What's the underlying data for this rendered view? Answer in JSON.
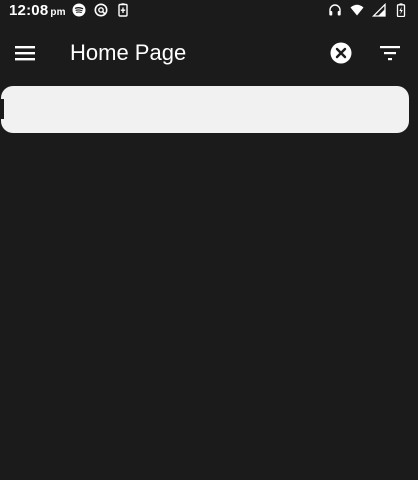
{
  "status_bar": {
    "time": "12:08",
    "ampm": "pm",
    "left_icons": [
      "spotify-icon",
      "vpn-icon",
      "battery-saver-icon"
    ],
    "right_icons": [
      "headphones-icon",
      "wifi-icon",
      "signal-icon",
      "battery-icon"
    ]
  },
  "app_bar": {
    "title": "Home Page",
    "menu_icon": "menu-icon",
    "clear_icon": "clear-circle-icon",
    "filter_icon": "filter-icon"
  },
  "search": {
    "value": "",
    "placeholder": ""
  },
  "colors": {
    "background": "#1b1b1b",
    "search_field": "#f1f1f1",
    "text": "#ffffff"
  }
}
